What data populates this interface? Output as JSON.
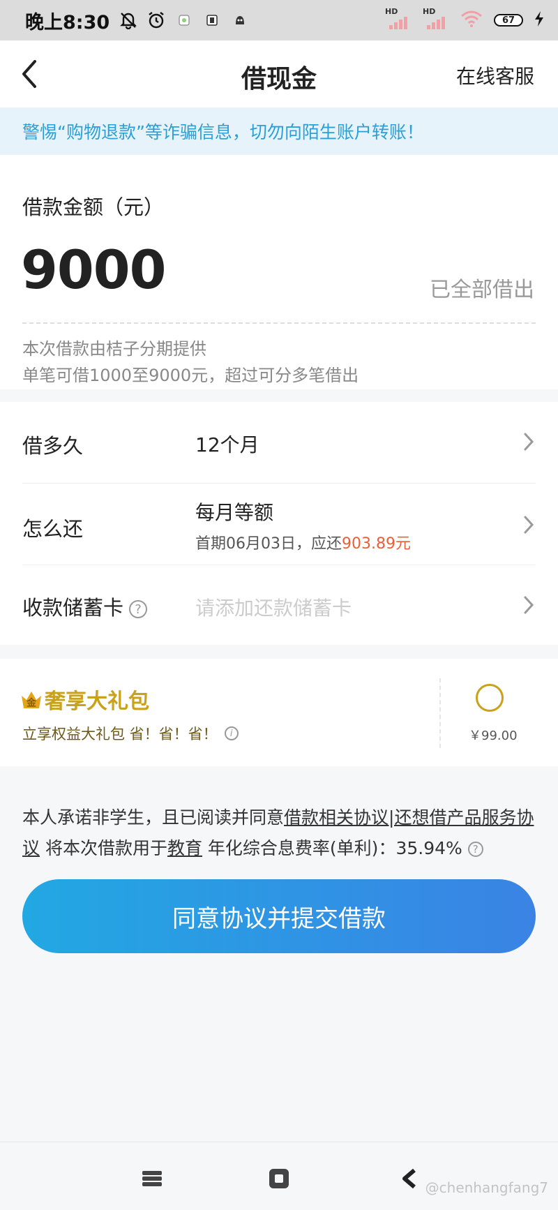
{
  "status_bar": {
    "time": "晚上8:30",
    "signal1_label": "HD",
    "signal2_label": "HD",
    "battery": "67"
  },
  "header": {
    "title": "借现金",
    "customer_service": "在线客服"
  },
  "alert": {
    "text": "警惕“购物退款”等诈骗信息，切勿向陌生账户转账！"
  },
  "amount": {
    "label": "借款金额（元）",
    "value": "9000",
    "status": "已全部借出",
    "note_provider": "本次借款由桔子分期提供",
    "note_limit": "单笔可借1000至9000元，超过可分多笔借出"
  },
  "terms": {
    "duration_label": "借多久",
    "duration_value": "12个月",
    "repay_label": "怎么还",
    "repay_method": "每月等额",
    "repay_first_prefix": "首期06月03日，应还",
    "repay_first_amount": "903.89元",
    "card_label": "收款储蓄卡",
    "card_placeholder": "请添加还款储蓄卡"
  },
  "gift": {
    "badge": "金",
    "title": "奢享大礼包",
    "desc": "立享权益大礼包 省！省！省！",
    "price": "￥99.00"
  },
  "agreement": {
    "text1": "本人承诺非学生，且已阅读并同意",
    "link1": "借款相关协议|还想借产品服务协议",
    "text2": " 将本次借款用于",
    "link2": "教育",
    "text3": " 年化综合息费率(单利)：35.94%"
  },
  "submit": {
    "label": "同意协议并提交借款"
  },
  "watermark": {
    "text": "@chenhangfang7"
  },
  "colors": {
    "accent": "#2b9fd6",
    "amount_highlight": "#e8603a",
    "gold": "#c9a11a",
    "button_gradient_start": "#22a8e3",
    "button_gradient_end": "#3a83e4"
  }
}
